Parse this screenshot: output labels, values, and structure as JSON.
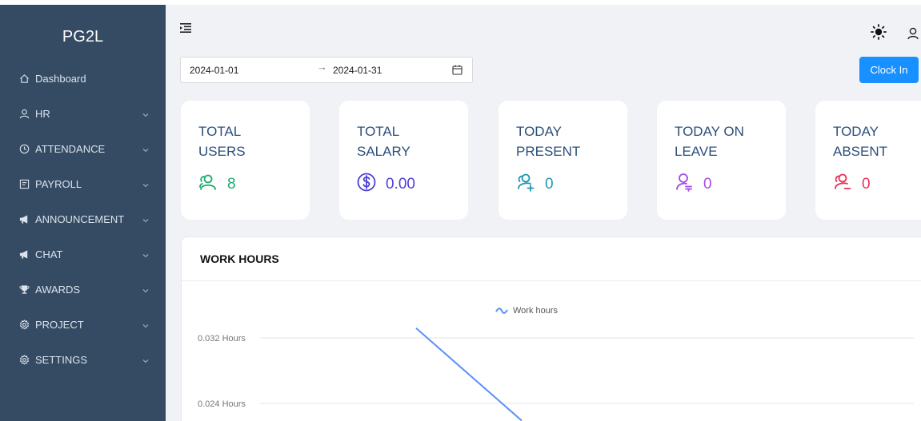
{
  "app": {
    "brand": "PG2L"
  },
  "sidebar": {
    "items": [
      {
        "label": "Dashboard",
        "icon": "home-icon",
        "has_children": false
      },
      {
        "label": "HR",
        "icon": "user-icon",
        "has_children": true
      },
      {
        "label": "ATTENDANCE",
        "icon": "clock-icon",
        "has_children": true
      },
      {
        "label": "PAYROLL",
        "icon": "form-icon",
        "has_children": true
      },
      {
        "label": "ANNOUNCEMENT",
        "icon": "megaphone-icon",
        "has_children": true
      },
      {
        "label": "CHAT",
        "icon": "megaphone-icon",
        "has_children": true
      },
      {
        "label": "AWARDS",
        "icon": "trophy-icon",
        "has_children": true
      },
      {
        "label": "PROJECT",
        "icon": "gear-icon",
        "has_children": true
      },
      {
        "label": "SETTINGS",
        "icon": "gear-icon",
        "has_children": true
      }
    ]
  },
  "header": {
    "menu_toggle_icon": "menu-fold-icon",
    "theme_icon": "sun-icon",
    "user_icon": "user-icon"
  },
  "filters": {
    "start_date": "2024-01-01",
    "end_date": "2024-01-31",
    "separator": "→"
  },
  "actions": {
    "clock_in": "Clock In"
  },
  "stats": [
    {
      "label_line1": "TOTAL",
      "label_line2": "USERS",
      "value": "8",
      "icon": "users-icon",
      "color": "#1aaa6f"
    },
    {
      "label_line1": "TOTAL",
      "label_line2": "SALARY",
      "value": "0.00",
      "icon": "dollar-icon",
      "color": "#4e40d8"
    },
    {
      "label_line1": "TODAY",
      "label_line2": "PRESENT",
      "value": "0",
      "icon": "user-add-icon",
      "color": "#1d99b5"
    },
    {
      "label_line1": "TODAY ON",
      "label_line2": "LEAVE",
      "value": "0",
      "icon": "user-leave-icon",
      "color": "#a64be8"
    },
    {
      "label_line1": "TODAY",
      "label_line2": "ABSENT",
      "value": "0",
      "icon": "user-remove-icon",
      "color": "#e8335a"
    }
  ],
  "work_hours": {
    "title": "WORK HOURS",
    "chart_data": {
      "type": "line",
      "title": "",
      "xlabel": "",
      "ylabel": "",
      "y_ticks": [
        "0.032 Hours",
        "0.024 Hours"
      ],
      "y_tick_values": [
        0.032,
        0.024
      ],
      "legend": "top-center",
      "grid": true,
      "series": [
        {
          "name": "Work hours",
          "color": "#5b8ff9",
          "values": [
            {
              "x": 1,
              "y": 0.0332
            },
            {
              "x": 2,
              "y": 0.0219
            }
          ]
        }
      ]
    }
  },
  "colors": {
    "sidebar_bg": "#344b63",
    "primary": "#1890ff",
    "card_title": "#2b4f7a"
  }
}
